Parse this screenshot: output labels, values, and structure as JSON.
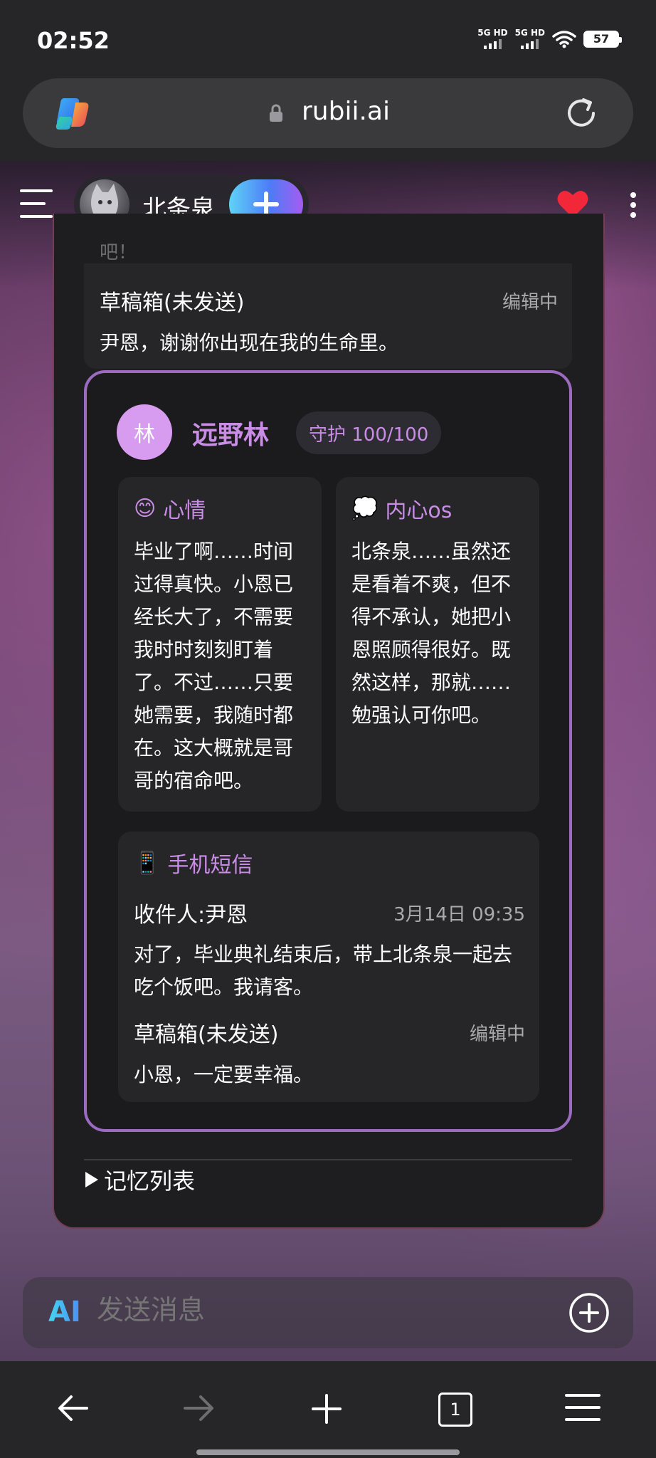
{
  "status_bar": {
    "time": "02:52",
    "sim1": "5G HD",
    "sim2": "5G HD",
    "battery": "57"
  },
  "browser": {
    "url": "rubii.ai"
  },
  "chat_header": {
    "character_name": "北条泉"
  },
  "previous_message": {
    "cut_text": "吧！",
    "draft_title": "草稿箱(未发送)",
    "draft_state": "编辑中",
    "draft_body": "尹恩，谢谢你出现在我的生命里。"
  },
  "status_card": {
    "avatar_char": "林",
    "name": "远野林",
    "guard_badge": "守护 100/100",
    "mood": {
      "icon": "😊",
      "title": "心情",
      "text": "毕业了啊……时间过得真快。小恩已经长大了，不需要我时时刻刻盯着了。不过……只要她需要，我随时都在。这大概就是哥哥的宿命吧。"
    },
    "inner": {
      "icon": "💭",
      "title": "内心os",
      "text": "北条泉……虽然还是看着不爽，但不得不承认，她把小恩照顾得很好。既然这样，那就……勉强认可你吧。"
    },
    "sms": {
      "icon": "📱",
      "title": "手机短信",
      "recipient": "收件人:尹恩",
      "time": "3月14日 09:35",
      "body": "对了，毕业典礼结束后，带上北条泉一起去吃个饭吧。我请客。",
      "draft_title": "草稿箱(未发送)",
      "draft_state": "编辑中",
      "draft_body": "小恩，一定要幸福。"
    }
  },
  "memory": {
    "label": "记忆列表"
  },
  "composer": {
    "ai_label": "AI",
    "placeholder": "发送消息"
  },
  "bottom_nav": {
    "tab_count": "1"
  }
}
